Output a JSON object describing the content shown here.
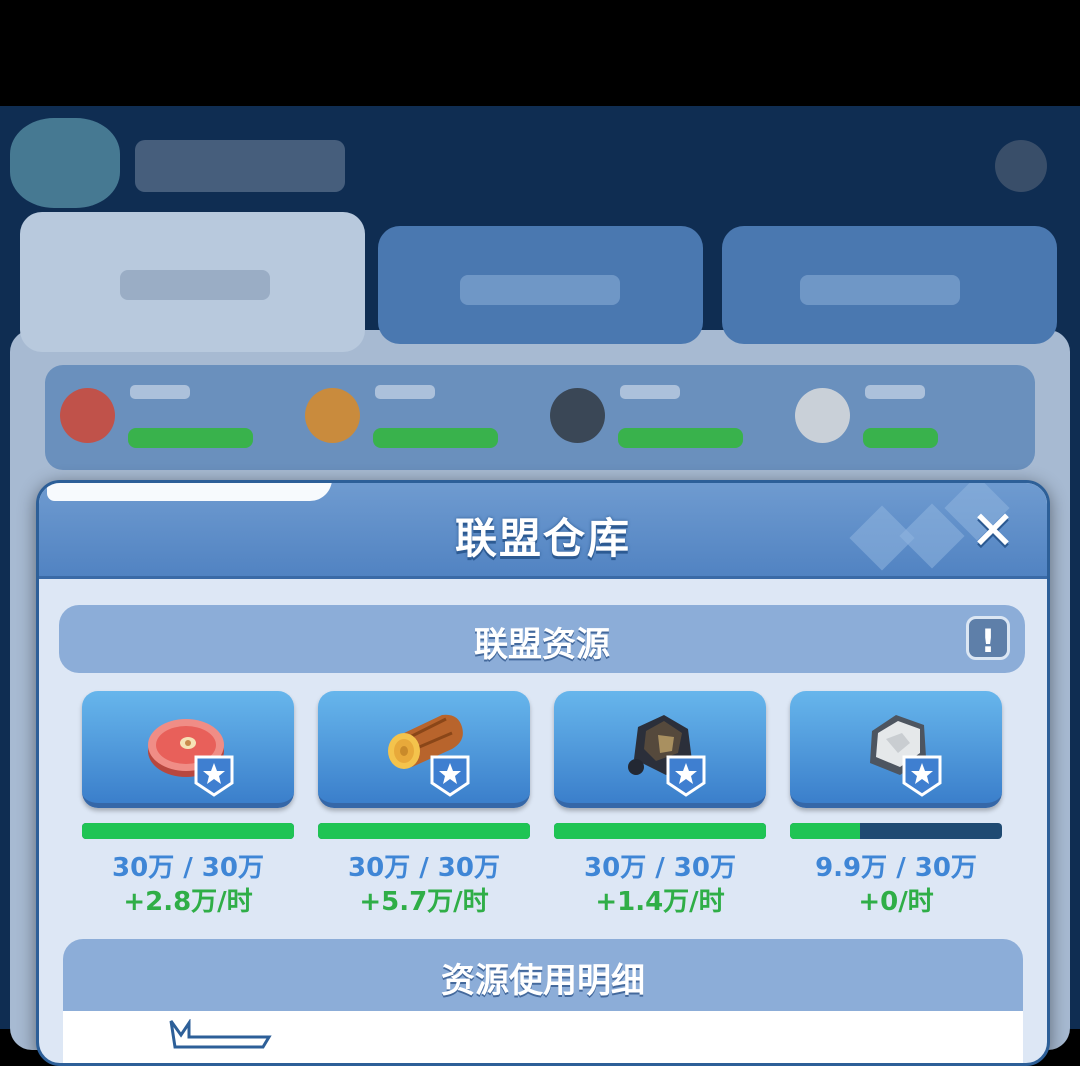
{
  "dialog": {
    "title": "联盟仓库",
    "close_glyph": "✕"
  },
  "resources_section": {
    "title": "联盟资源",
    "info_glyph": "!"
  },
  "resources": [
    {
      "icon": "meat-icon",
      "amount": "30万 / 30万",
      "rate": "+2.8万/时",
      "fill_percent": 100
    },
    {
      "icon": "wood-log-icon",
      "amount": "30万 / 30万",
      "rate": "+5.7万/时",
      "fill_percent": 100
    },
    {
      "icon": "coal-ore-icon",
      "amount": "30万 / 30万",
      "rate": "+1.4万/时",
      "fill_percent": 100
    },
    {
      "icon": "iron-ore-icon",
      "amount": "9.9万 / 30万",
      "rate": "+0/时",
      "fill_percent": 33
    }
  ],
  "usage_section": {
    "title": "资源使用明细"
  },
  "colors": {
    "bar_fill": "#1fc454",
    "bar_empty": "#1f4a72",
    "amount_text": "#3f86d6",
    "rate_text": "#2fae47",
    "header_blue": "#5183c2"
  }
}
